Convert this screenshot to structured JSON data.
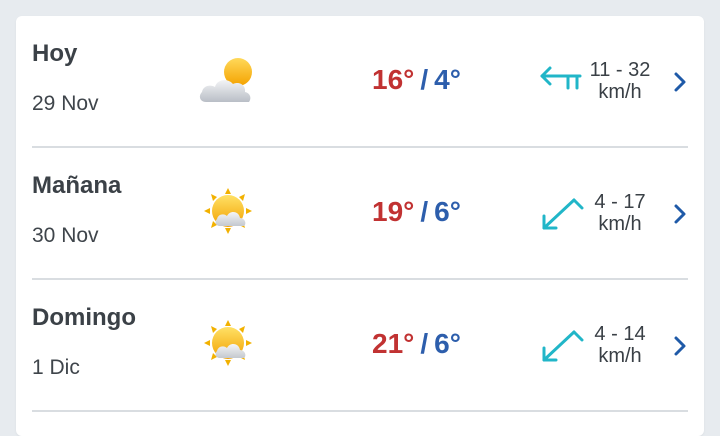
{
  "forecast": [
    {
      "day": "Hoy",
      "date": "29 Nov",
      "weather_icon": "partly-cloudy-icon",
      "temp_max": "16°",
      "temp_separator": "/",
      "temp_min": "4°",
      "wind_direction_icon": "west-wind-arrow-icon",
      "wind_speed": "11 - 32",
      "wind_unit": "km/h"
    },
    {
      "day": "Mañana",
      "date": "30 Nov",
      "weather_icon": "sunny-few-clouds-icon",
      "temp_max": "19°",
      "temp_separator": "/",
      "temp_min": "6°",
      "wind_direction_icon": "southwest-wind-arrow-icon",
      "wind_speed": "4 - 17",
      "wind_unit": "km/h"
    },
    {
      "day": "Domingo",
      "date": "1 Dic",
      "weather_icon": "sunny-few-clouds-icon",
      "temp_max": "21°",
      "temp_separator": "/",
      "temp_min": "6°",
      "wind_direction_icon": "southwest-wind-arrow-icon",
      "wind_speed": "4 - 14",
      "wind_unit": "km/h"
    }
  ],
  "colors": {
    "background": "#e7ebef",
    "card": "#ffffff",
    "temp_max": "#c13232",
    "temp_min": "#2d5eac",
    "wind_arrow": "#21b6c8",
    "chevron": "#1f5aa8"
  }
}
